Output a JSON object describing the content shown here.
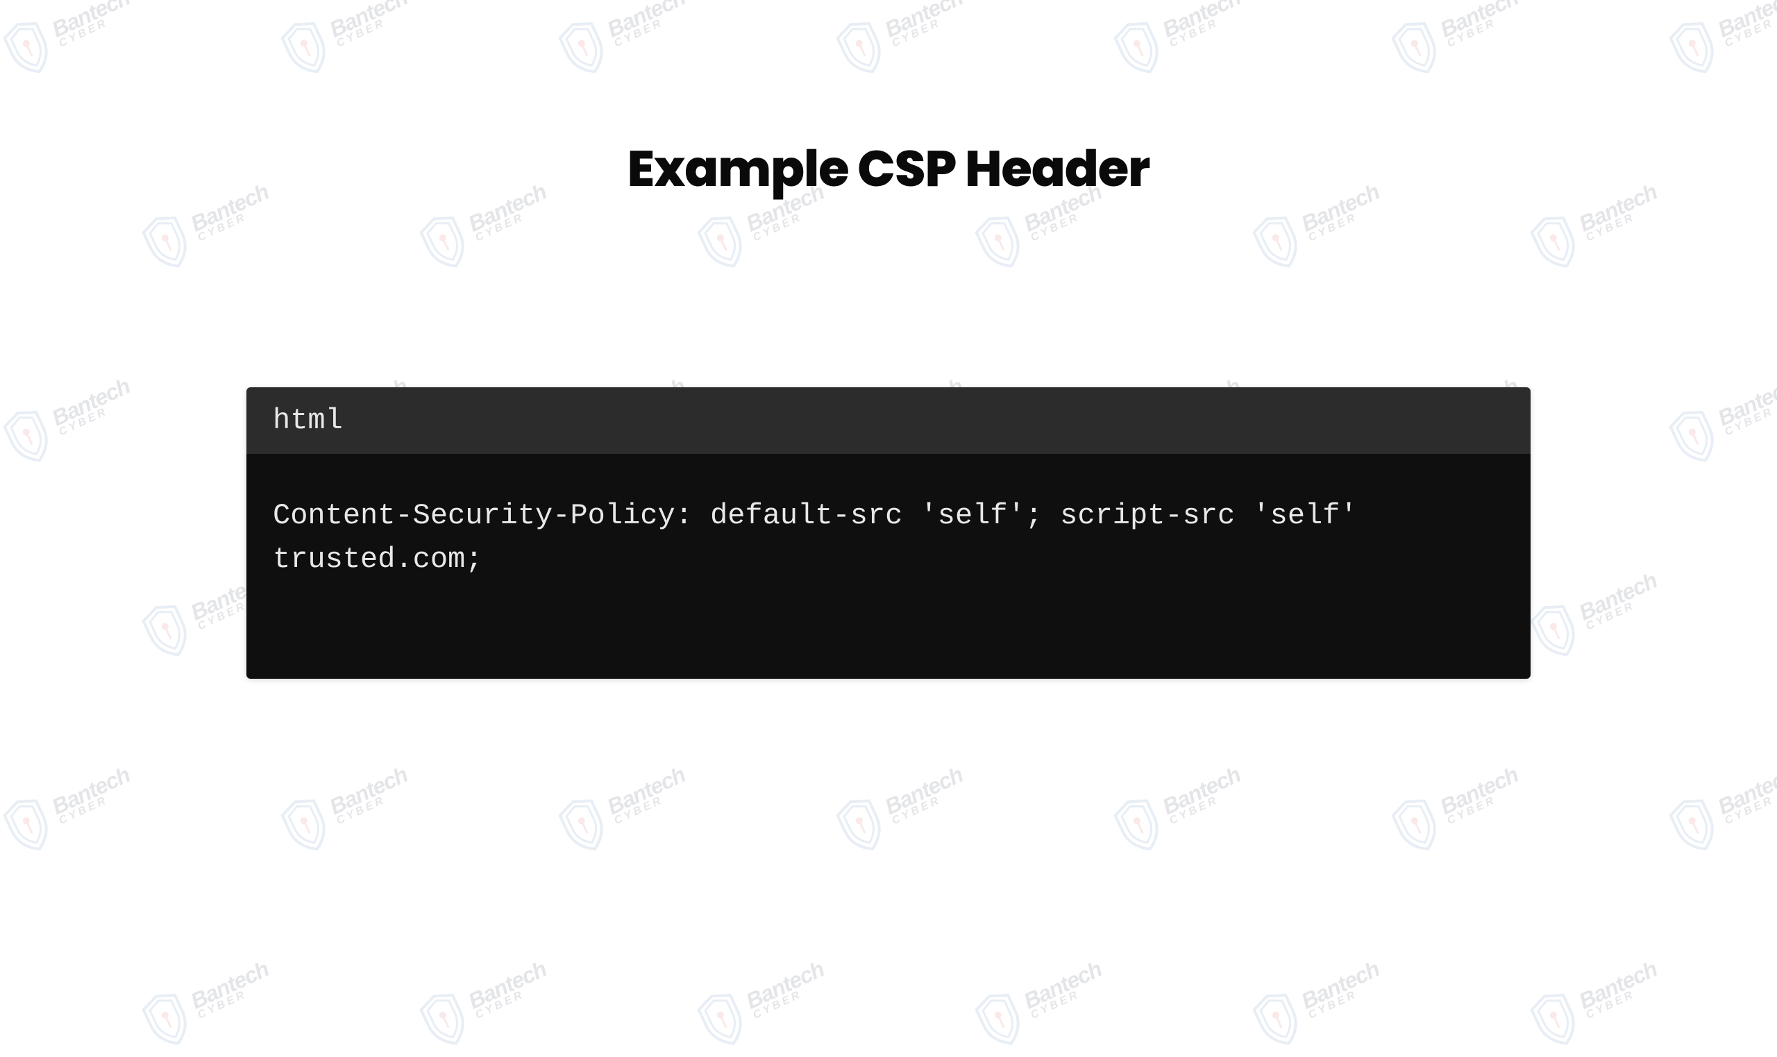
{
  "heading": "Example CSP Header",
  "code": {
    "language": "html",
    "content": "Content-Security-Policy: default-src 'self'; script-src 'self' trusted.com;"
  },
  "watermark": {
    "brand": "Bantech",
    "sub": "CYBER"
  }
}
